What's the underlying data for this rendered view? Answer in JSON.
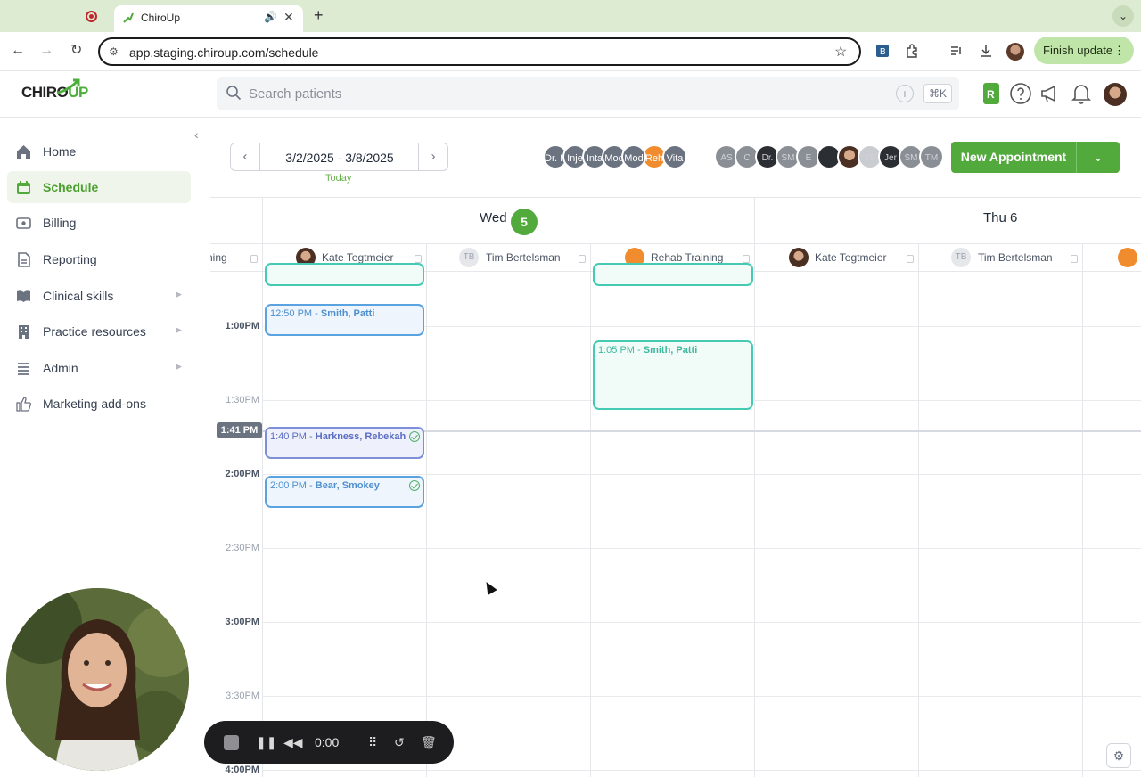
{
  "browser": {
    "tab_title": "ChiroUp",
    "url": "app.staging.chiroup.com/schedule",
    "finish_update_label": "Finish update"
  },
  "header": {
    "logo_text": "CHIRO",
    "logo_accent": "UP",
    "search_placeholder": "Search patients",
    "search_shortcut": "⌘K"
  },
  "sidebar": {
    "items": [
      {
        "label": "Home",
        "icon": "home-icon"
      },
      {
        "label": "Schedule",
        "icon": "calendar-icon",
        "active": true
      },
      {
        "label": "Billing",
        "icon": "billing-icon"
      },
      {
        "label": "Reporting",
        "icon": "report-icon"
      },
      {
        "label": "Clinical skills",
        "icon": "book-icon",
        "has_submenu": true
      },
      {
        "label": "Practice resources",
        "icon": "building-icon",
        "has_submenu": true
      },
      {
        "label": "Admin",
        "icon": "list-icon",
        "has_submenu": true
      },
      {
        "label": "Marketing add-ons",
        "icon": "thumbs-up-icon"
      }
    ]
  },
  "schedule": {
    "date_range": "3/2/2025 - 3/8/2025",
    "today_label": "Today",
    "new_appointment_label": "New Appointment",
    "filter_chips": [
      "Dr. Ima",
      "Inje",
      "Inta",
      "Mod",
      "Reh",
      "Vita"
    ],
    "staff_chips": [
      "AS",
      "C",
      "Dr.",
      "SM",
      "E",
      "",
      "",
      "TE",
      "Jer",
      "SM",
      "TM"
    ],
    "days": [
      {
        "label": "Wed",
        "number": "5",
        "is_today": true
      },
      {
        "label": "Thu 6",
        "is_today": false
      }
    ],
    "providers": [
      {
        "name": "ning",
        "avatar": "none"
      },
      {
        "name": "Kate Tegtmeier",
        "avatar": "photo"
      },
      {
        "name": "Tim Bertelsman",
        "avatar": "initials",
        "initials": "TB"
      },
      {
        "name": "Rehab Training",
        "avatar": "orange"
      },
      {
        "name": "Kate Tegtmeier",
        "avatar": "photo"
      },
      {
        "name": "Tim Bertelsman",
        "avatar": "initials",
        "initials": "TB"
      },
      {
        "name": "",
        "avatar": "orange"
      }
    ],
    "time_labels": [
      {
        "label": "1:00PM",
        "kind": "hour"
      },
      {
        "label": "1:30PM",
        "kind": "half"
      },
      {
        "label": "2:00PM",
        "kind": "hour"
      },
      {
        "label": "2:30PM",
        "kind": "half"
      },
      {
        "label": "3:00PM",
        "kind": "hour"
      },
      {
        "label": "3:30PM",
        "kind": "half"
      },
      {
        "label": "4:00PM",
        "kind": "hour"
      }
    ],
    "current_time": "1:41 PM",
    "appointments": [
      {
        "time": "12:50 PM",
        "patient": "Smith, Patti",
        "column": "Kate Tegtmeier (Wed)",
        "checked_in": false
      },
      {
        "time": "1:05 PM",
        "patient": "Smith, Patti",
        "column": "Rehab Training (Wed)",
        "checked_in": false
      },
      {
        "time": "1:40 PM",
        "patient": "Harkness, Rebekah",
        "column": "Kate Tegtmeier (Wed)",
        "checked_in": true
      },
      {
        "time": "2:00 PM",
        "patient": "Bear, Smokey",
        "column": "Kate Tegtmeier (Wed)",
        "checked_in": true
      }
    ]
  },
  "recorder": {
    "elapsed": "0:00"
  },
  "colors": {
    "brand_green": "#52a93c",
    "appt_blue": "#5ba2e0",
    "appt_teal": "#45cbb3",
    "appt_purple": "#7d8fd8",
    "rehab_orange": "#f08c2d"
  }
}
